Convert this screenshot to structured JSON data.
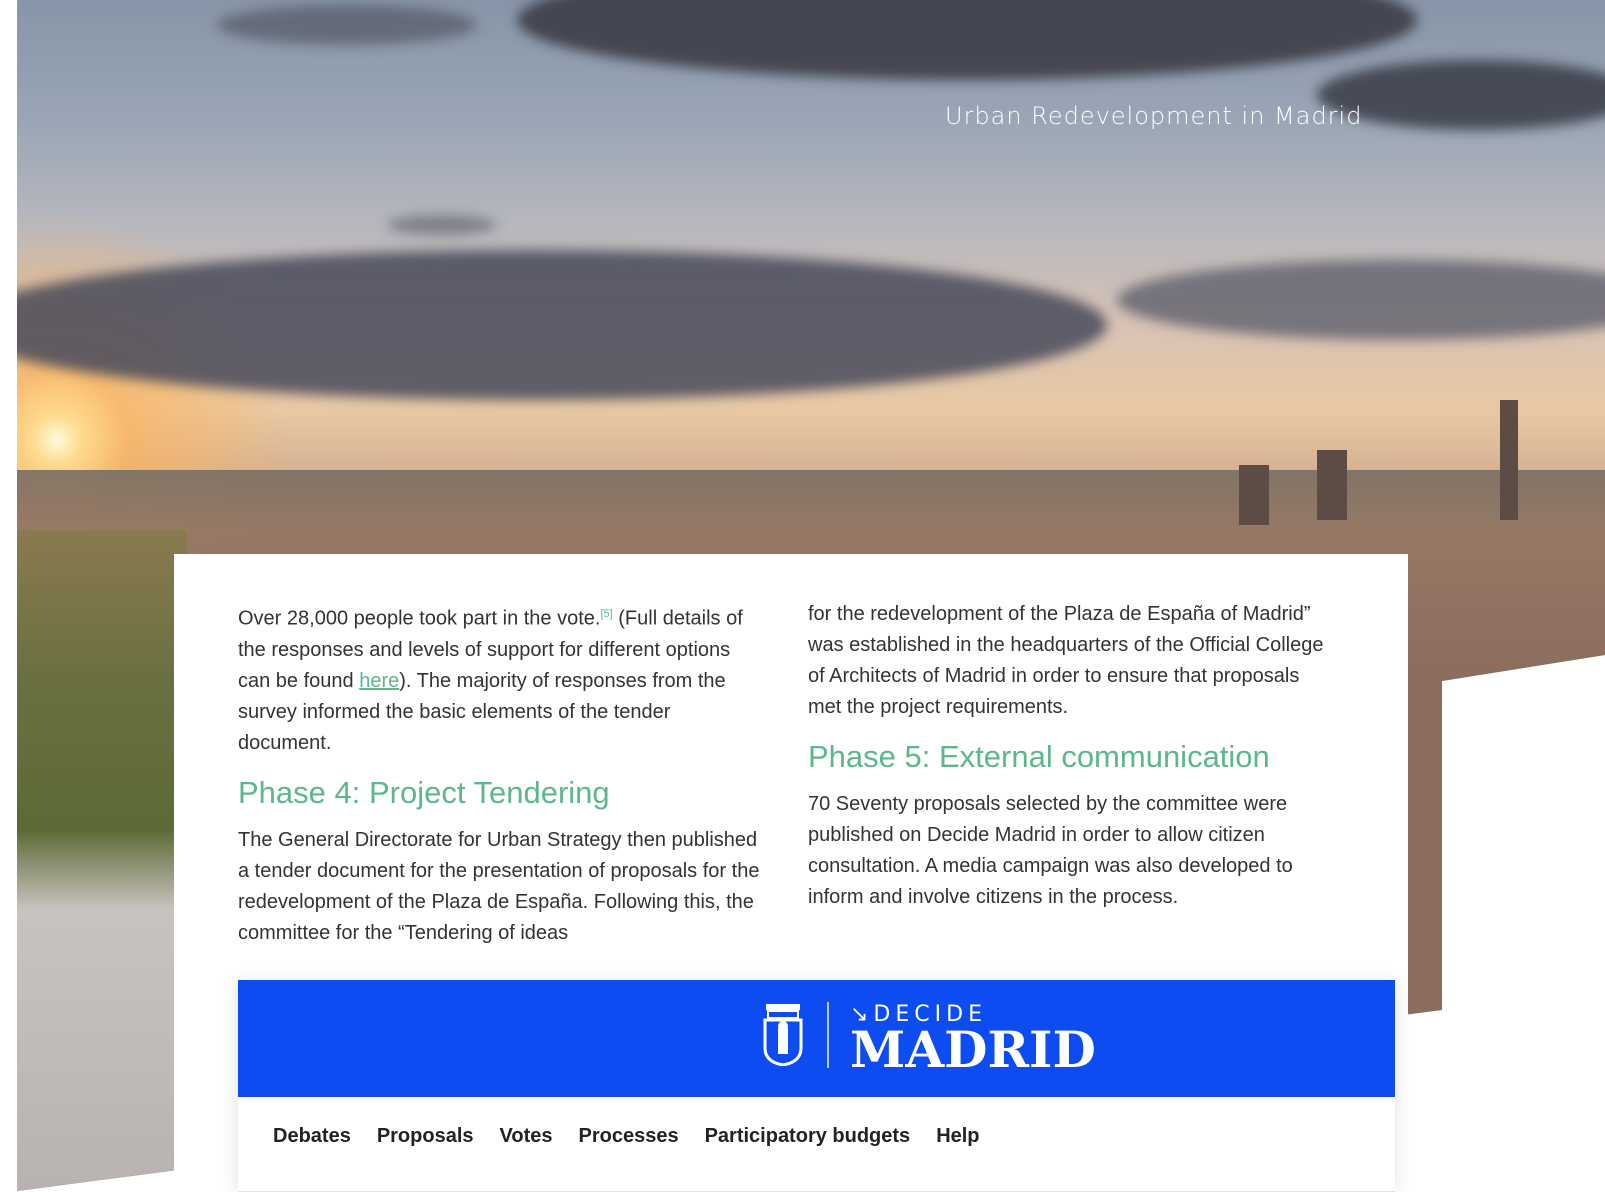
{
  "hero": {
    "title": "Urban Redevelopment in Madrid"
  },
  "content": {
    "left": {
      "intro_before": "Over 28,000 people took part in the vote.",
      "footnote": "[5]",
      "intro_mid": " (Full details of the responses and levels of support for different options can be found ",
      "link_text": "here",
      "intro_after": "). The majority of responses from the survey informed the basic elements of the tender document.",
      "heading": "Phase 4: Project Tendering",
      "body": "The General Directorate for Urban Strategy then published a tender document for the presentation of proposals for the redevelopment of the Plaza de España. Following this, the committee for the “Tendering of ideas"
    },
    "right": {
      "intro": "for the redevelopment of the Plaza de España of Madrid” was established in the headquarters of the Official College of Architects of Madrid in order to ensure that proposals met the project requirements.",
      "heading": "Phase 5: External communication",
      "body": "70 Seventy proposals selected by the committee were published on Decide Madrid in order to allow citizen consultation. A media campaign was also developed to inform and involve citizens in the process."
    }
  },
  "embed": {
    "brand_color": "#0c4cf0",
    "logo_sub": "↘DECIDE",
    "logo_main": "MADRID",
    "nav": [
      "Debates",
      "Proposals",
      "Votes",
      "Processes",
      "Participatory budgets",
      "Help"
    ]
  },
  "colors": {
    "accent": "#5cb88b",
    "text": "#333333"
  }
}
